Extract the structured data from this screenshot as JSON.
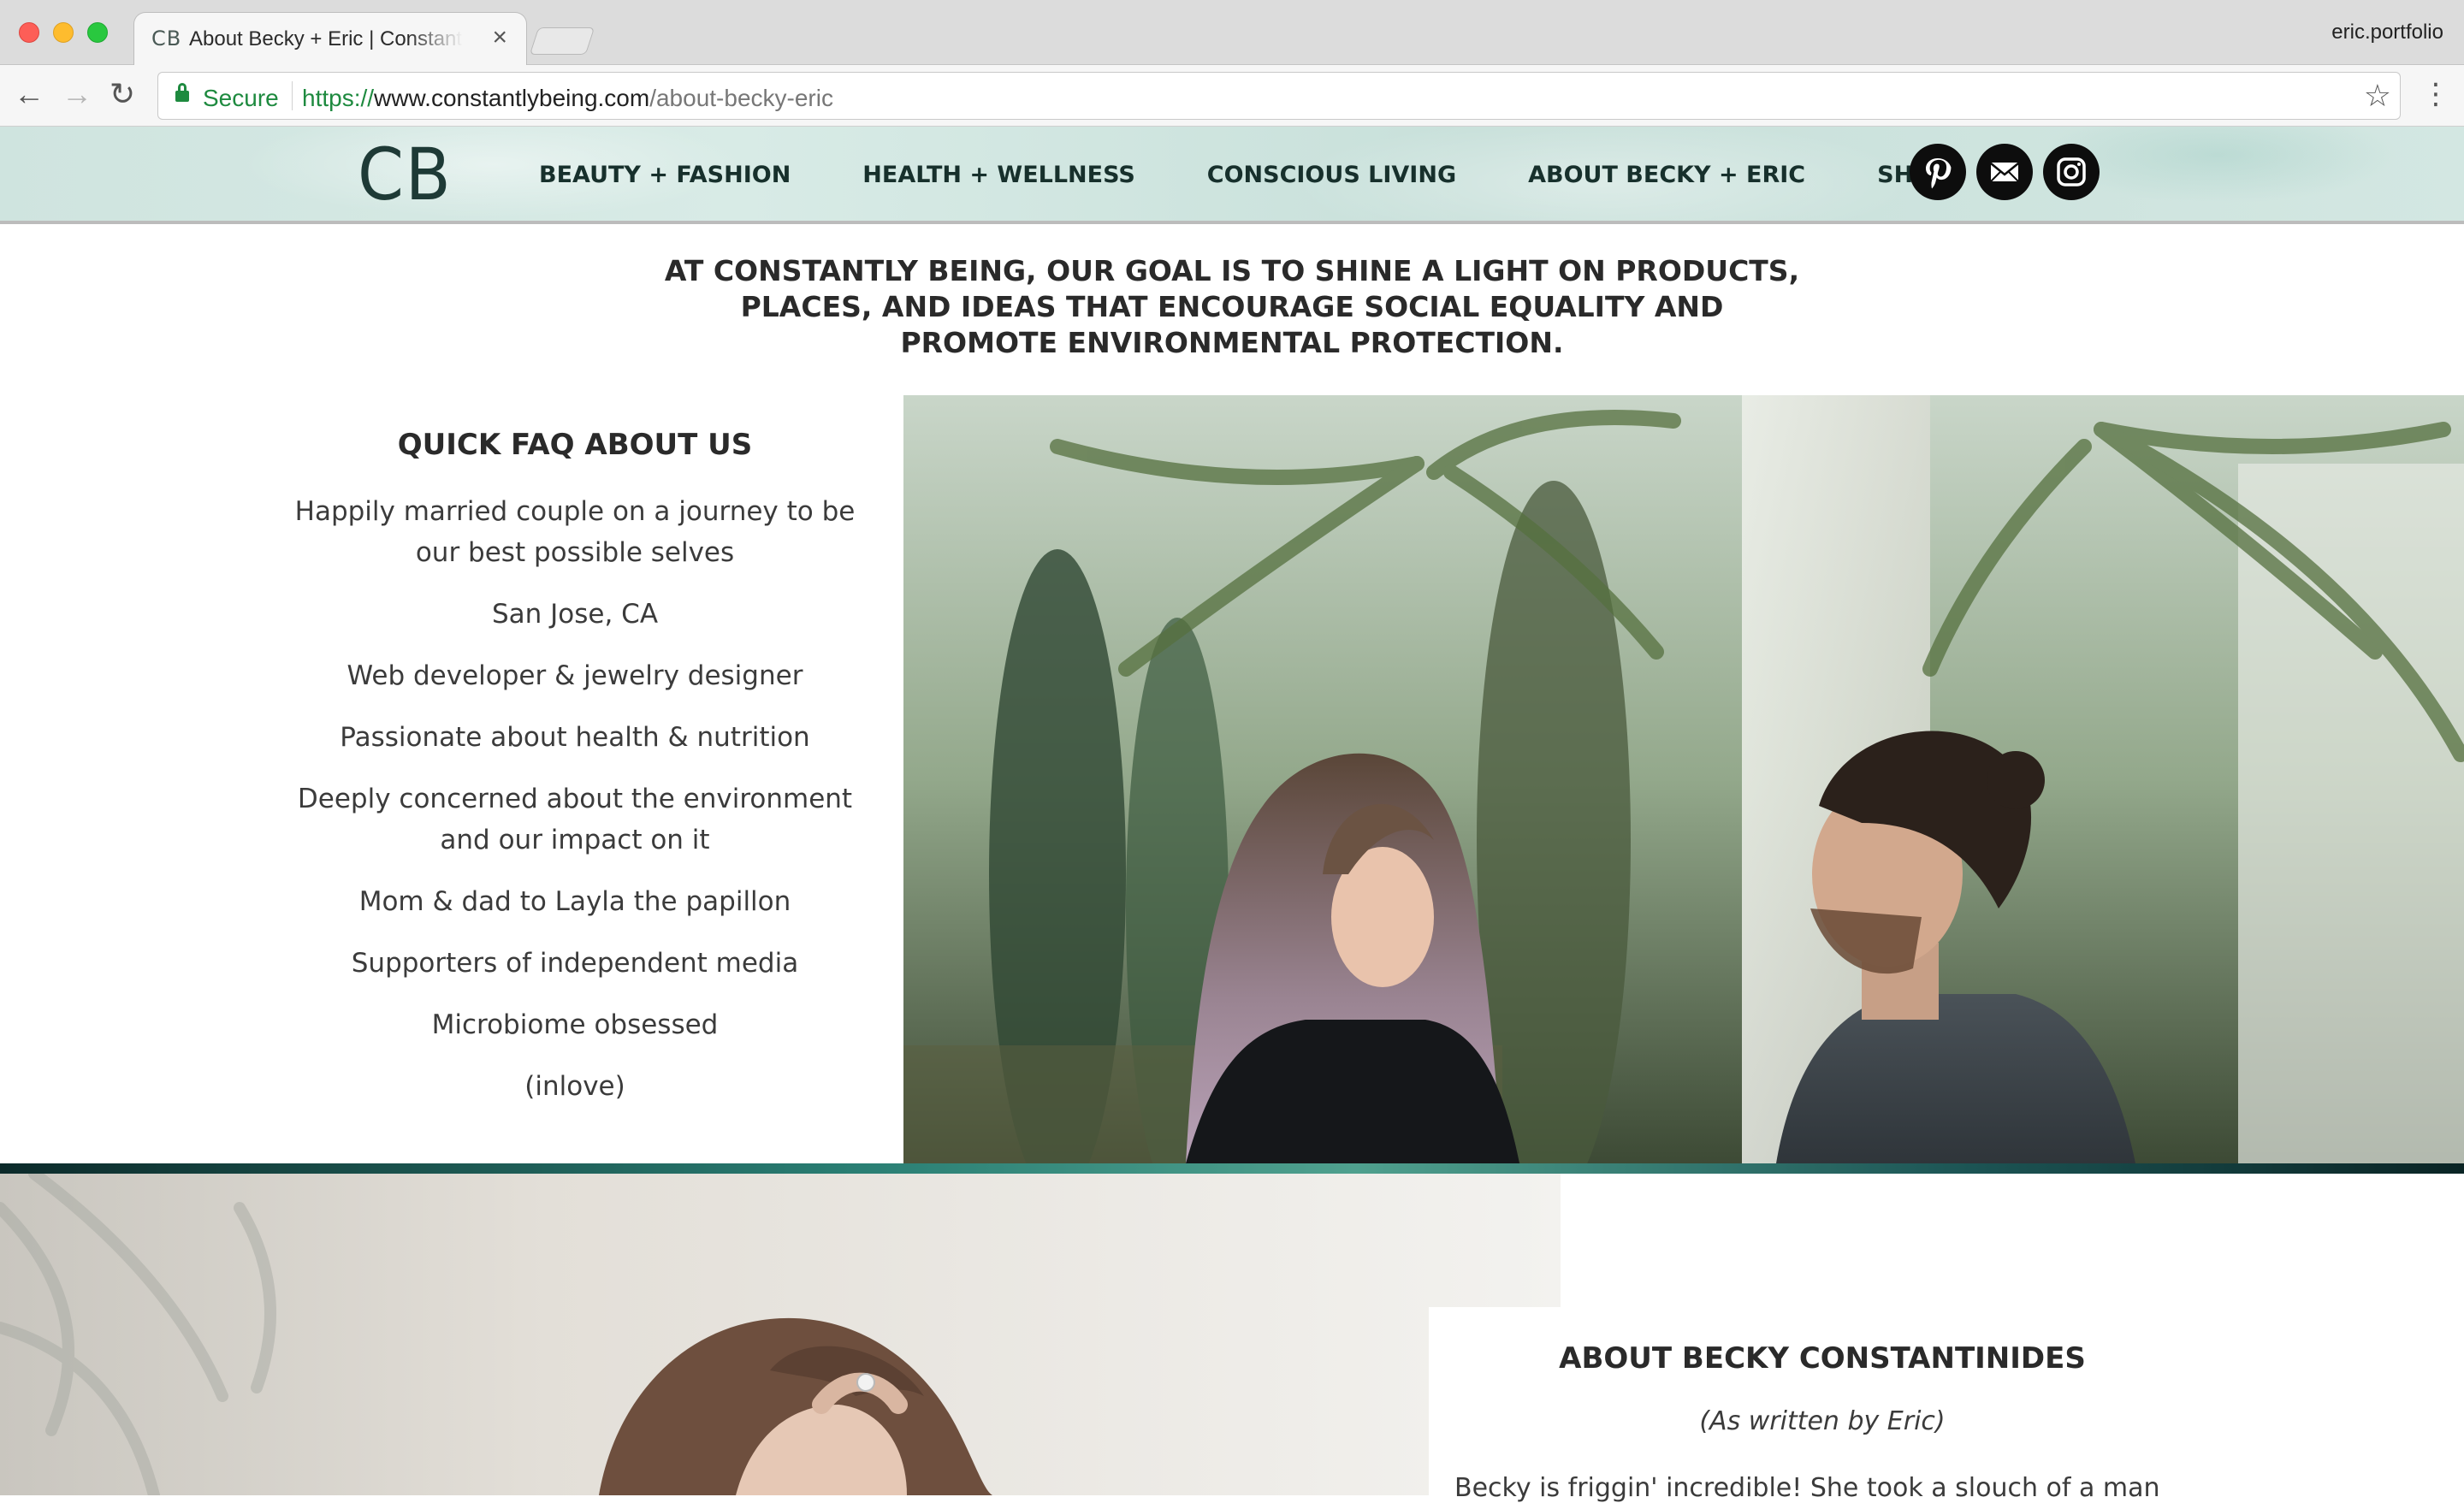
{
  "browser": {
    "tab_favicon": "CB",
    "tab_title": "About Becky + Eric | Constantly Being",
    "tab_close": "×",
    "profile_name": "eric.portfolio",
    "secure_label": "Secure",
    "url_scheme": "https://",
    "url_host": "www.constantlybeing.com",
    "url_path": "/about-becky-eric",
    "back_glyph": "←",
    "forward_glyph": "→",
    "reload_glyph": "↻",
    "star_glyph": "☆",
    "menu_glyph": "⋮"
  },
  "site": {
    "logo": "CB",
    "nav": [
      "BEAUTY + FASHION",
      "HEALTH + WELLNESS",
      "CONSCIOUS LIVING",
      "ABOUT BECKY + ERIC",
      "SHOP"
    ],
    "social_icons": [
      "pinterest-icon",
      "email-icon",
      "instagram-icon"
    ]
  },
  "mission": "AT CONSTANTLY BEING, OUR GOAL IS TO SHINE A LIGHT ON PRODUCTS, PLACES, AND IDEAS THAT ENCOURAGE SOCIAL EQUALITY AND PROMOTE ENVIRONMENTAL PROTECTION.",
  "faq": {
    "title": "QUICK FAQ ABOUT US",
    "items": [
      "Happily married couple on a journey to be our best possible selves",
      "San Jose, CA",
      "Web developer & jewelry designer",
      "Passionate about health & nutrition",
      "Deeply concerned about the environment and our impact on it",
      "Mom & dad to Layla the papillon",
      "Supporters of independent media",
      "Microbiome obsessed",
      "(inlove)"
    ]
  },
  "about": {
    "title": "ABOUT BECKY CONSTANTINIDES",
    "subtitle": "(As written by Eric)",
    "body": "Becky is friggin' incredible! She took a slouch of a man"
  },
  "colors": {
    "header_teal": "#d3e7e2",
    "nav_text": "#17302c",
    "divider_teal": "#2a7f74",
    "secure_green": "#1e8a3f"
  }
}
